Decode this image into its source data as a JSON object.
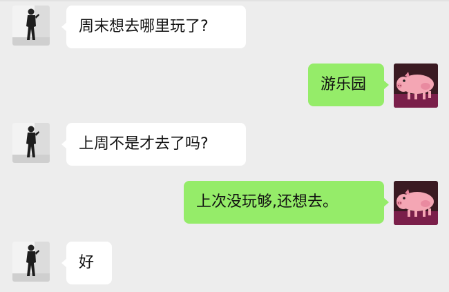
{
  "colors": {
    "background": "#ededed",
    "incoming_bubble": "#ffffff",
    "outgoing_bubble": "#95ec69"
  },
  "messages": [
    {
      "side": "incoming",
      "avatar": "person-avatar",
      "text": "周末想去哪里玩了?"
    },
    {
      "side": "outgoing",
      "avatar": "pig-avatar",
      "text": "游乐园"
    },
    {
      "side": "incoming",
      "avatar": "person-avatar",
      "text": "上周不是才去了吗?"
    },
    {
      "side": "outgoing",
      "avatar": "pig-avatar",
      "text": "上次没玩够,还想去。"
    },
    {
      "side": "incoming",
      "avatar": "person-avatar",
      "text": "好"
    }
  ]
}
